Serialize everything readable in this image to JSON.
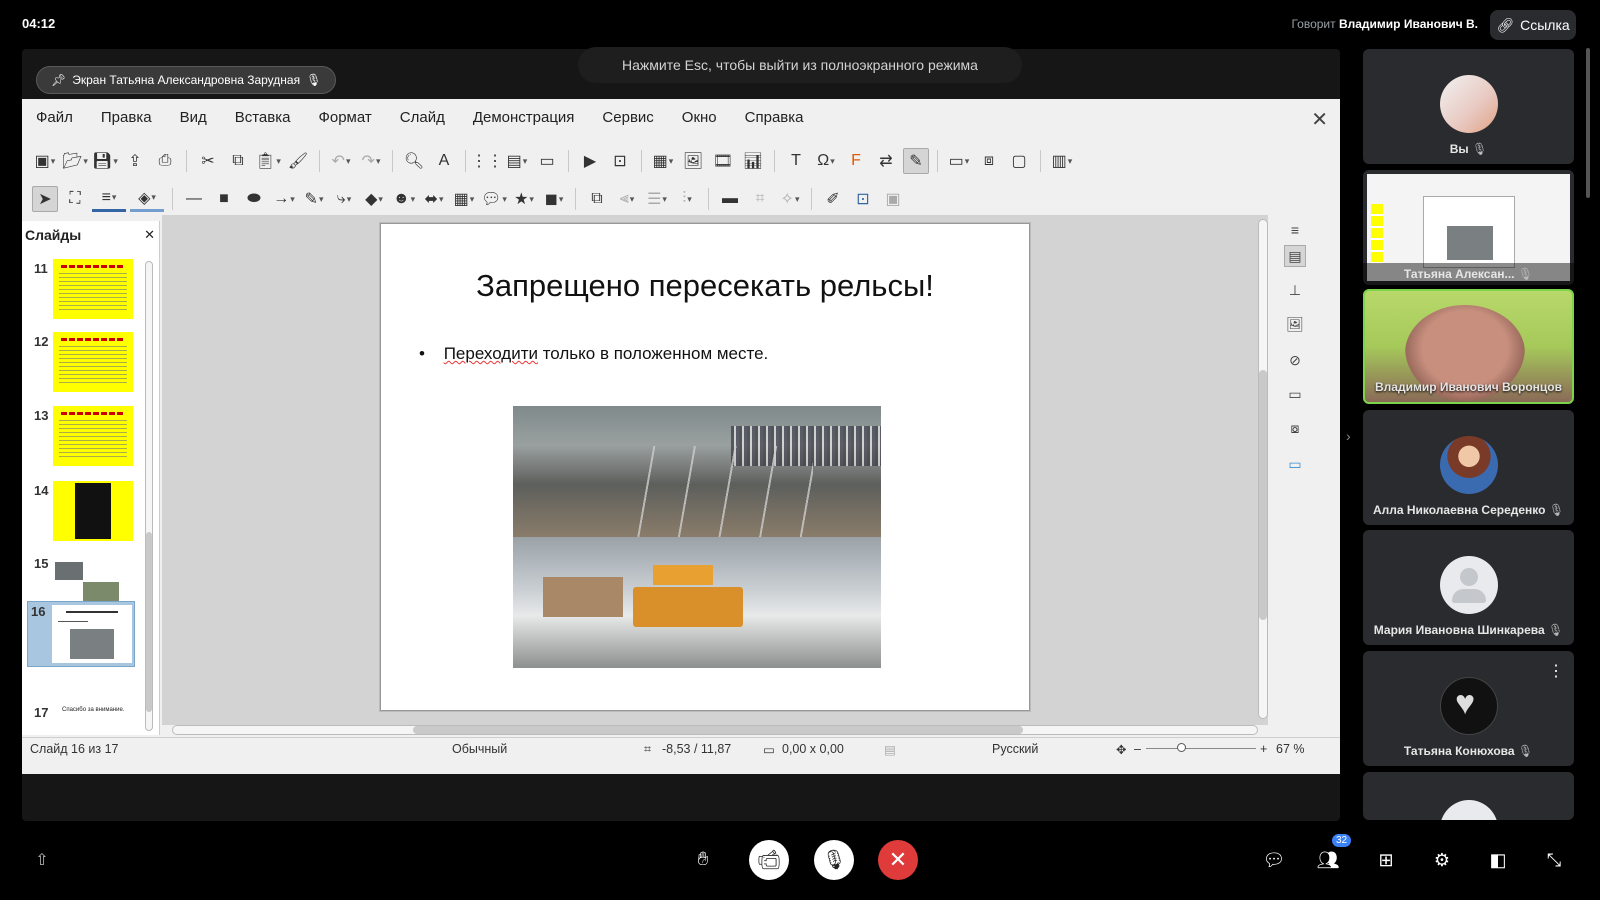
{
  "top": {
    "clock": "04:12",
    "speaking_prefix": "Говорит",
    "speaking_name": "Владимир Иванович В.",
    "link_button": "Ссылка"
  },
  "share": {
    "esc_hint": "Нажмите Esc, чтобы выйти из полноэкранного режима",
    "screen_chip": "Экран Татьяна Александровна Зарудная"
  },
  "impress": {
    "menu": [
      "Файл",
      "Правка",
      "Вид",
      "Вставка",
      "Формат",
      "Слайд",
      "Демонстрация",
      "Сервис",
      "Окно",
      "Справка"
    ],
    "slides_pane_title": "Слайды",
    "thumbnails": [
      {
        "num": "11"
      },
      {
        "num": "12"
      },
      {
        "num": "13"
      },
      {
        "num": "14"
      },
      {
        "num": "15"
      },
      {
        "num": "16"
      },
      {
        "num": "17",
        "text": "Спасибо за внимание."
      }
    ],
    "slide": {
      "title": "Запрещено пересекать рельсы!",
      "bullet_prefix": "•",
      "bullet_word": "Переходити",
      "bullet_rest": " только в положенном месте."
    },
    "status": {
      "slide_info": "Слайд 16 из 17",
      "layout": "Обычный",
      "position": "-8,53 / 11,87",
      "size": "0,00 x 0,00",
      "language": "Русский",
      "zoom": "67 %"
    }
  },
  "participants": [
    {
      "name": "Вы"
    },
    {
      "name": "Татьяна Алексан..."
    },
    {
      "name": "Владимир Иванович Воронцов"
    },
    {
      "name": "Алла Николаевна Середенко"
    },
    {
      "name": "Мария Ивановна Шинкарева"
    },
    {
      "name": "Татьяна Конюхова"
    }
  ],
  "bottom": {
    "participants_count": "32"
  },
  "colors": {
    "leave": "#e03b3b",
    "active_speaker_border": "#7bd44a",
    "badge": "#3b82f6"
  }
}
